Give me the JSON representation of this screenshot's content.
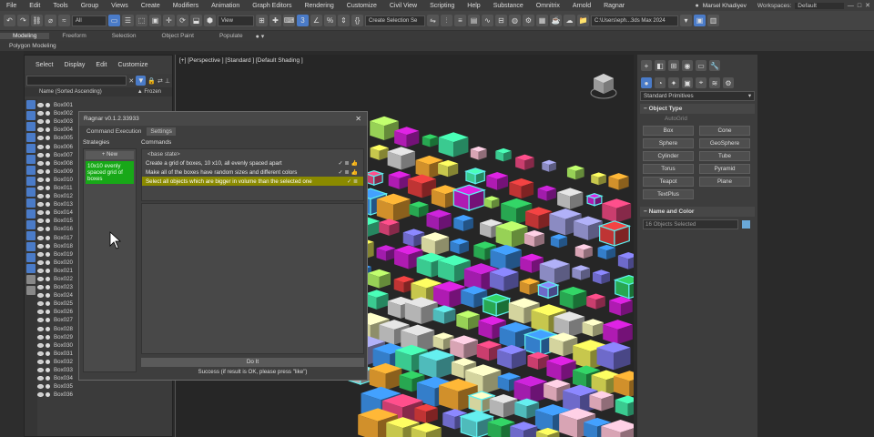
{
  "menubar": {
    "items": [
      "File",
      "Edit",
      "Tools",
      "Group",
      "Views",
      "Create",
      "Modifiers",
      "Animation",
      "Graph Editors",
      "Rendering",
      "Customize",
      "Civil View",
      "Scripting",
      "Help",
      "Substance",
      "Omnitrix",
      "Arnold",
      "Ragnar"
    ],
    "user": "Marsel Khadiyev",
    "workspaces_label": "Workspaces:",
    "workspace_value": "Default"
  },
  "toolbar": {
    "filter_value": "All",
    "view_value": "View",
    "selection_set_placeholder": "Create Selection Se",
    "path_value": "C:\\Users\\eph...3ds Max 2024"
  },
  "ribbon": {
    "tabs": [
      "Modeling",
      "Freeform",
      "Selection",
      "Object Paint",
      "Populate"
    ],
    "subtitle": "Polygon Modeling"
  },
  "explorer": {
    "menu": [
      "Select",
      "Display",
      "Edit",
      "Customize"
    ],
    "header_name": "Name (Sorted Ascending)",
    "header_frozen": "▲ Frozen",
    "rows": [
      "Box001",
      "Box002",
      "Box003",
      "Box004",
      "Box005",
      "Box006",
      "Box007",
      "Box008",
      "Box009",
      "Box010",
      "Box011",
      "Box012",
      "Box013",
      "Box014",
      "Box015",
      "Box016",
      "Box017",
      "Box018",
      "Box019",
      "Box020",
      "Box021",
      "Box022",
      "Box023",
      "Box024",
      "Box025",
      "Box026",
      "Box027",
      "Box028",
      "Box029",
      "Box030",
      "Box031",
      "Box032",
      "Box033",
      "Box034",
      "Box035",
      "Box036"
    ]
  },
  "viewport": {
    "label": "[+] [Perspective ] [Standard ] [Default Shading ]"
  },
  "ragnar": {
    "title": "Ragnar v0.1.2.33933",
    "tabs": [
      "Command Execution",
      "Settings"
    ],
    "strategies_label": "Strategies",
    "new_button": "+ New",
    "strategy_item": "10x10 evenly spaced grid of boxes",
    "commands_label": "Commands",
    "base_state": "<base state>",
    "commands": [
      "Create a grid of boxes, 10 x10, all evenly spaced apart",
      "Make all of the boxes have random sizes and different colors",
      "Select all objects which are bigger in volume than the selected one"
    ],
    "do_it": "Do It",
    "status": "Success (if result is OK, please press \"like\")"
  },
  "command_panel": {
    "category": "Standard Primitives",
    "object_type_title": "Object Type",
    "autogrid": "AutoGrid",
    "buttons": [
      "Box",
      "Cone",
      "Sphere",
      "GeoSphere",
      "Cylinder",
      "Tube",
      "Torus",
      "Pyramid",
      "Teapot",
      "Plane",
      "TextPlus"
    ],
    "name_color_title": "Name and Color",
    "name_value": "16 Objects Selected",
    "swatch_color": "#6aa9d9"
  }
}
